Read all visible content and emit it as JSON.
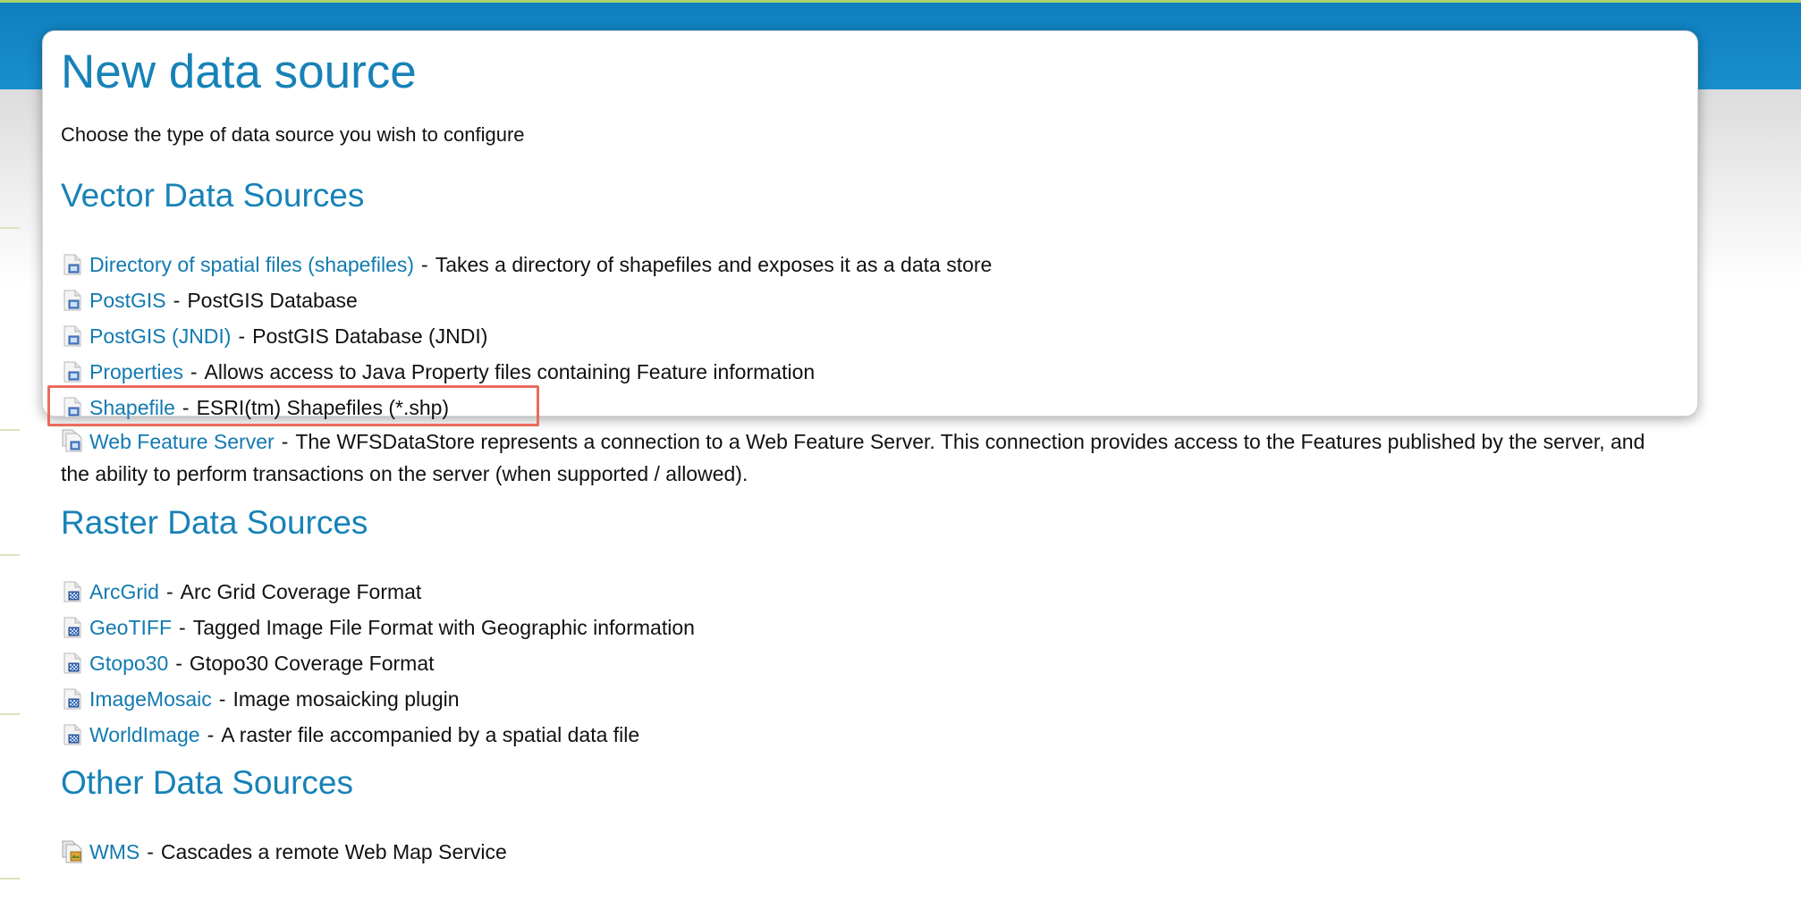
{
  "page": {
    "title": "New data source",
    "intro": "Choose the type of data source you wish to configure"
  },
  "sections": {
    "vector": {
      "heading": "Vector Data Sources",
      "items": [
        {
          "name": "Directory of spatial files (shapefiles)",
          "description": "Takes a directory of shapefiles and exposes it as a data store",
          "icon": "vector-store-icon"
        },
        {
          "name": "PostGIS",
          "description": "PostGIS Database",
          "icon": "vector-store-icon"
        },
        {
          "name": "PostGIS (JNDI)",
          "description": "PostGIS Database (JNDI)",
          "icon": "vector-store-icon"
        },
        {
          "name": "Properties",
          "description": "Allows access to Java Property files containing Feature information",
          "icon": "vector-store-icon"
        },
        {
          "name": "Shapefile",
          "description": "ESRI(tm) Shapefiles (*.shp)",
          "icon": "vector-store-icon"
        },
        {
          "name": "Web Feature Server",
          "description": "The WFSDataStore represents a connection to a Web Feature Server. This connection provides access to the Features published by the server, and the ability to perform transactions on the server (when supported / allowed).",
          "icon": "wfs-store-icon"
        }
      ]
    },
    "raster": {
      "heading": "Raster Data Sources",
      "items": [
        {
          "name": "ArcGrid",
          "description": "Arc Grid Coverage Format",
          "icon": "raster-store-icon"
        },
        {
          "name": "GeoTIFF",
          "description": "Tagged Image File Format with Geographic information",
          "icon": "raster-store-icon"
        },
        {
          "name": "Gtopo30",
          "description": "Gtopo30 Coverage Format",
          "icon": "raster-store-icon"
        },
        {
          "name": "ImageMosaic",
          "description": "Image mosaicking plugin",
          "icon": "raster-store-icon"
        },
        {
          "name": "WorldImage",
          "description": "A raster file accompanied by a spatial data file",
          "icon": "raster-store-icon"
        }
      ]
    },
    "other": {
      "heading": "Other Data Sources",
      "items": [
        {
          "name": "WMS",
          "description": "Cascades a remote Web Map Service",
          "icon": "wms-store-icon"
        }
      ]
    }
  },
  "separator": "-",
  "colors": {
    "header_blue": "#1782b7",
    "link": "#127ab0",
    "highlight_border": "#ea6b5d",
    "top_band": "#0f7fbf"
  },
  "highlighted_item": "Shapefile"
}
